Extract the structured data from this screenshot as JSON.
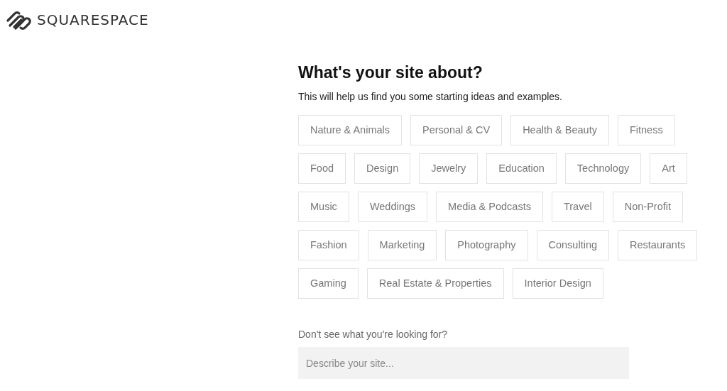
{
  "brand": {
    "name": "SQUARESPACE"
  },
  "heading": "What's your site about?",
  "subtitle": "This will help us find you some starting ideas and examples.",
  "topic_rows": [
    [
      "Nature & Animals",
      "Personal & CV",
      "Health & Beauty",
      "Fitness"
    ],
    [
      "Food",
      "Design",
      "Jewelry",
      "Education",
      "Technology",
      "Art"
    ],
    [
      "Music",
      "Weddings",
      "Media & Podcasts",
      "Travel",
      "Non-Profit"
    ],
    [
      "Fashion",
      "Marketing",
      "Photography",
      "Consulting",
      "Restaurants"
    ],
    [
      "Gaming",
      "Real Estate & Properties",
      "Interior Design"
    ]
  ],
  "custom": {
    "label": "Don't see what you're looking for?",
    "placeholder": "Describe your site..."
  }
}
